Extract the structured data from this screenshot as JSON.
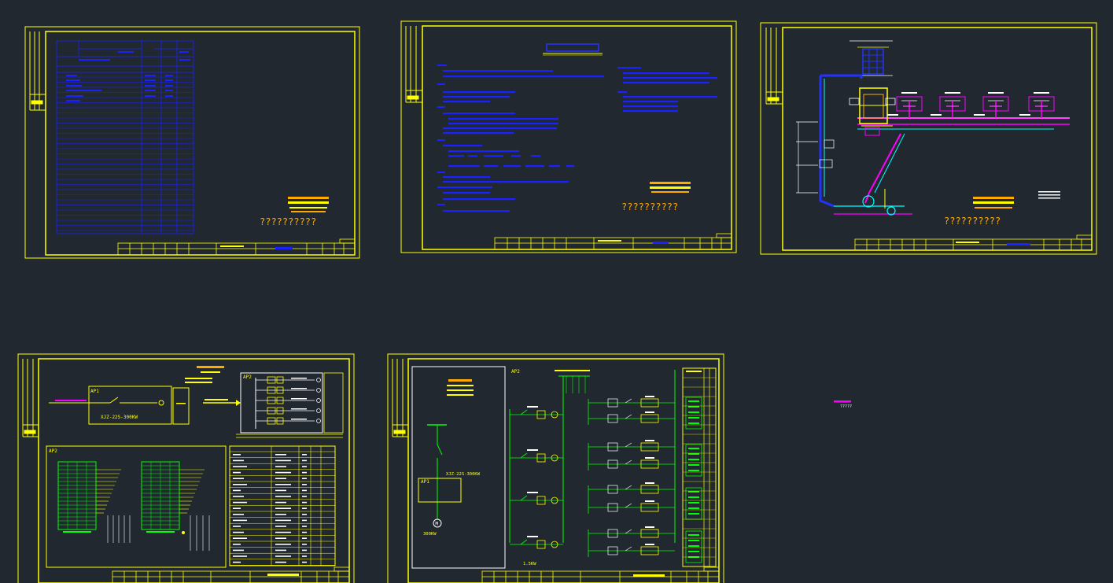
{
  "colors": {
    "background": "#212830",
    "frame": "#ffff00",
    "blue_text": "#1a22ff",
    "magenta": "#ff00ff",
    "cyan": "#00ffff",
    "green": "#00ff00",
    "orange": "#ffaa00",
    "white": "#ffffff"
  },
  "sheets": [
    {
      "id": "sheet-1",
      "kind": "drawing-index",
      "annotation": "??????????"
    },
    {
      "id": "sheet-2",
      "kind": "design-notes",
      "annotation": "??????????"
    },
    {
      "id": "sheet-3",
      "kind": "piping-layout",
      "annotation": "??????????"
    },
    {
      "id": "sheet-4",
      "kind": "distribution-diagram",
      "labels": {
        "ap1": "AP1",
        "ap2": "AP2",
        "ap2_top": "AP2",
        "cabinet": "XJZ-22S-300KW"
      }
    },
    {
      "id": "sheet-5",
      "kind": "control-schematic",
      "labels": {
        "ap1": "AP1",
        "ap2": "AP2",
        "cabinet": "XJZ-22S-300KW",
        "motor": "M",
        "motor_rating": "300KW",
        "bottom": "1.5KW"
      }
    }
  ],
  "floating_label": "?????"
}
